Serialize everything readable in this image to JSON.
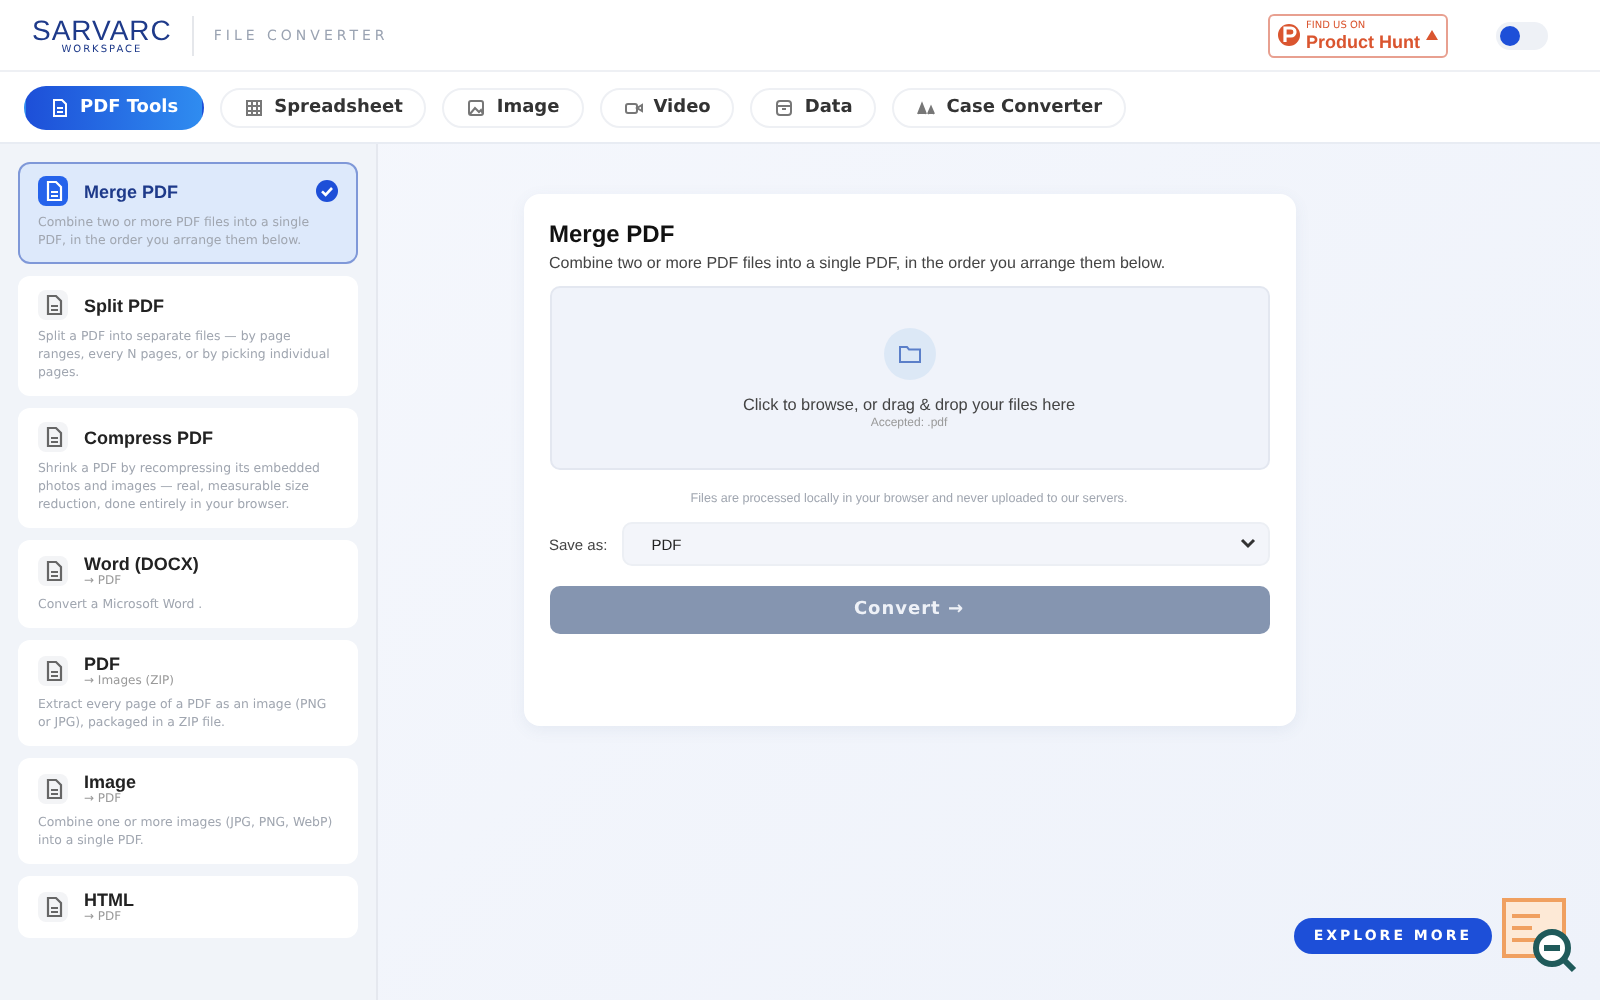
{
  "header": {
    "logo": "SARVARC",
    "logo_sub": "WORKSPACE",
    "app_title": "FILE CONVERTER",
    "badge": {
      "kicker": "FIND US ON",
      "name": "Product Hunt"
    },
    "theme_toggle": {
      "on": false
    }
  },
  "tabs": [
    {
      "label": "PDF Tools",
      "selected": true
    },
    {
      "label": "Spreadsheet",
      "selected": false
    },
    {
      "label": "Image",
      "selected": false
    },
    {
      "label": "Video",
      "selected": false
    },
    {
      "label": "Data",
      "selected": false
    },
    {
      "label": "Case Converter",
      "selected": false
    }
  ],
  "sidebar": {
    "items": [
      {
        "title": "Merge PDF",
        "description": "Combine two or more PDF files into a single PDF, in the order you arrange them below.",
        "selected": true
      },
      {
        "title": "Split PDF",
        "description": "Split a PDF into separate files — by page ranges, every N pages, or by picking individual pages.",
        "selected": false
      },
      {
        "title": "Compress PDF",
        "description": "Shrink a PDF by recompressing its embedded photos and images — real, measurable size reduction, done entirely in your browser.",
        "selected": false
      },
      {
        "title": "Word (DOCX)",
        "subtitle": "→ PDF",
        "description": "Convert a Microsoft Word .",
        "selected": false
      },
      {
        "title": "PDF",
        "subtitle": "→ Images (ZIP)",
        "description": "Extract every page of a PDF as an image (PNG or JPG), packaged in a ZIP file.",
        "selected": false
      },
      {
        "title": "Image",
        "subtitle": "→ PDF",
        "description": "Combine one or more images (JPG, PNG, WebP) into a single PDF.",
        "selected": false
      },
      {
        "title": "HTML",
        "subtitle": "→ PDF",
        "selected": false
      }
    ]
  },
  "panel": {
    "title": "Merge PDF",
    "description": "Combine two or more PDF files into a single PDF, in the order you arrange them below.",
    "dropzone": {
      "prompt": "Click to browse, or drag & drop your files here",
      "accepted": "Accepted: .pdf"
    },
    "privacy_note": "Files are processed locally in your browser and never uploaded to our servers.",
    "save_as": {
      "label": "Save as:",
      "value": "PDF"
    },
    "convert": {
      "label": "Convert →",
      "disabled": true
    }
  },
  "explore": {
    "label": "EXPLORE MORE"
  }
}
